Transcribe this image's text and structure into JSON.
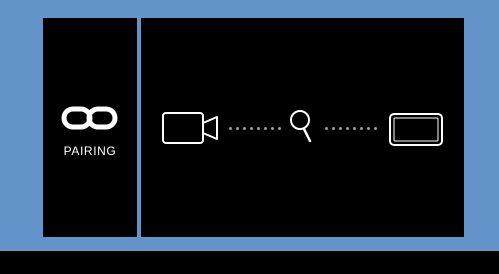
{
  "sidebar": {
    "label": "PAIRING",
    "icon": "link-icon"
  },
  "pairing_flow": {
    "steps": [
      "camera-icon",
      "magnifier-icon",
      "display-icon"
    ],
    "connector_color": "#9a9a9a"
  },
  "colors": {
    "background": "#6293c9",
    "panel": "#000000",
    "icon_stroke": "#ffffff"
  }
}
